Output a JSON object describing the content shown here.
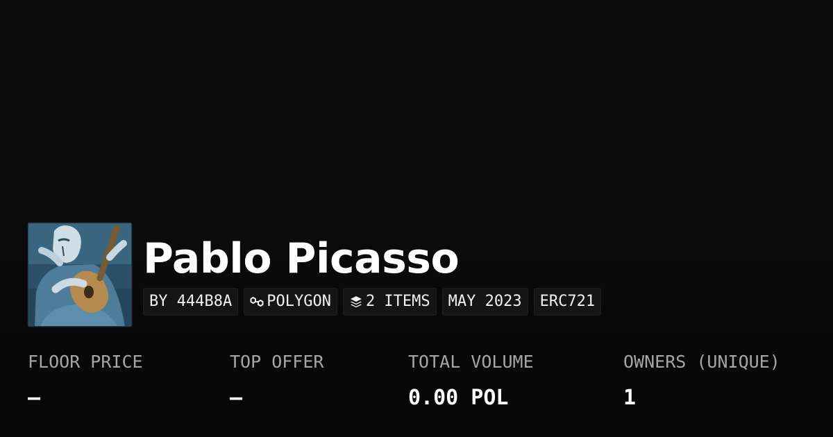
{
  "collection": {
    "name": "Pablo Picasso",
    "avatar_icon": "artwork-thumbnail-old-guitarist"
  },
  "chips": {
    "creator": "BY 444B8A",
    "chain": "POLYGON",
    "chain_icon": "polygon-chain-icon",
    "items": "2 ITEMS",
    "items_icon": "layers-icon",
    "date": "MAY 2023",
    "standard": "ERC721"
  },
  "stats": {
    "floor_price": {
      "label": "FLOOR PRICE",
      "value": "–"
    },
    "top_offer": {
      "label": "TOP OFFER",
      "value": "–"
    },
    "total_volume": {
      "label": "TOTAL VOLUME",
      "value": "0.00 POL"
    },
    "owners": {
      "label": "OWNERS (UNIQUE)",
      "value": "1"
    }
  },
  "colors": {
    "background": "#0c0c0c",
    "chip_background": "#151515",
    "label_gray": "#a6a6a6",
    "text_white": "#ffffff"
  }
}
